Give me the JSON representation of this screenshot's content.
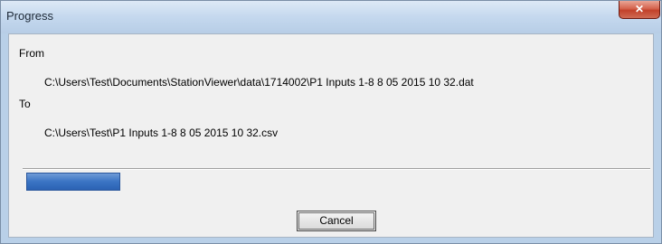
{
  "window": {
    "title": "Progress",
    "close_glyph": "✕"
  },
  "from": {
    "label": "From",
    "path": "C:\\Users\\Test\\Documents\\StationViewer\\data\\1714002\\P1 Inputs 1-8 8 05 2015 10 32.dat"
  },
  "to": {
    "label": "To",
    "path": "C:\\Users\\Test\\P1 Inputs 1-8 8 05 2015 10 32.csv"
  },
  "progress": {
    "fraction": 0.15
  },
  "buttons": {
    "cancel_label": "Cancel"
  },
  "colors": {
    "progress_fill": "#3a74c4",
    "close_button": "#c2412a"
  }
}
